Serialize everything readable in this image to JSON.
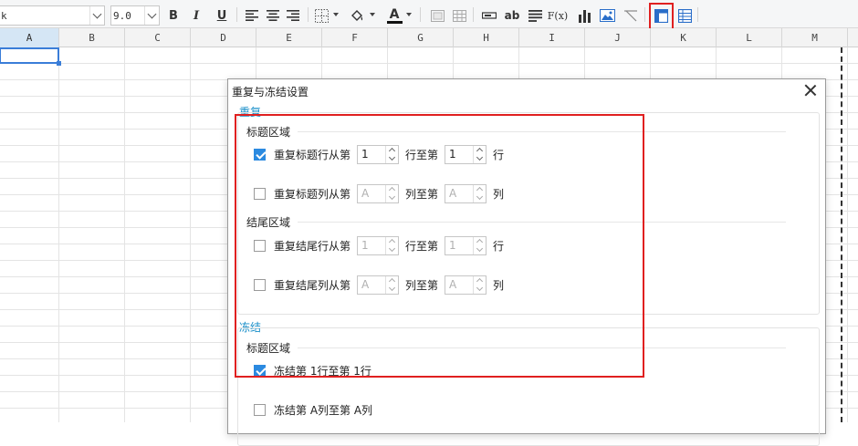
{
  "toolbar": {
    "font_name_value": "k",
    "font_size_value": "9.0",
    "bold_label": "B",
    "italic_label": "I",
    "underline_label": "U",
    "text_color_label": "A",
    "ab_label": "ab",
    "formula_label": "F(x)",
    "accent_red": "#e02020",
    "font_color_bar": "#111111"
  },
  "columns": [
    "A",
    "B",
    "C",
    "D",
    "E",
    "F",
    "G",
    "H",
    "I",
    "J",
    "K",
    "L",
    "M"
  ],
  "dialog": {
    "title": "重复与冻结设置",
    "repeat_section": {
      "title": "重复",
      "header_area": {
        "title": "标题区域",
        "row_repeat": {
          "checked": true,
          "prefix": "重复标题行从第",
          "from": "1",
          "middle": "行至第",
          "to": "1",
          "suffix": "行"
        },
        "col_repeat": {
          "checked": false,
          "prefix": "重复标题列从第",
          "from": "A",
          "middle": "列至第",
          "to": "A",
          "suffix": "列"
        }
      },
      "footer_area": {
        "title": "结尾区域",
        "row_repeat": {
          "checked": false,
          "prefix": "重复结尾行从第",
          "from": "1",
          "middle": "行至第",
          "to": "1",
          "suffix": "行"
        },
        "col_repeat": {
          "checked": false,
          "prefix": "重复结尾列从第",
          "from": "A",
          "middle": "列至第",
          "to": "A",
          "suffix": "列"
        }
      }
    },
    "freeze_section": {
      "title": "冻结",
      "header_area": {
        "title": "标题区域",
        "row_freeze": {
          "checked": true,
          "label": "冻结第 1行至第 1行"
        },
        "col_freeze": {
          "checked": false,
          "label": "冻结第 A列至第 A列"
        }
      }
    }
  }
}
